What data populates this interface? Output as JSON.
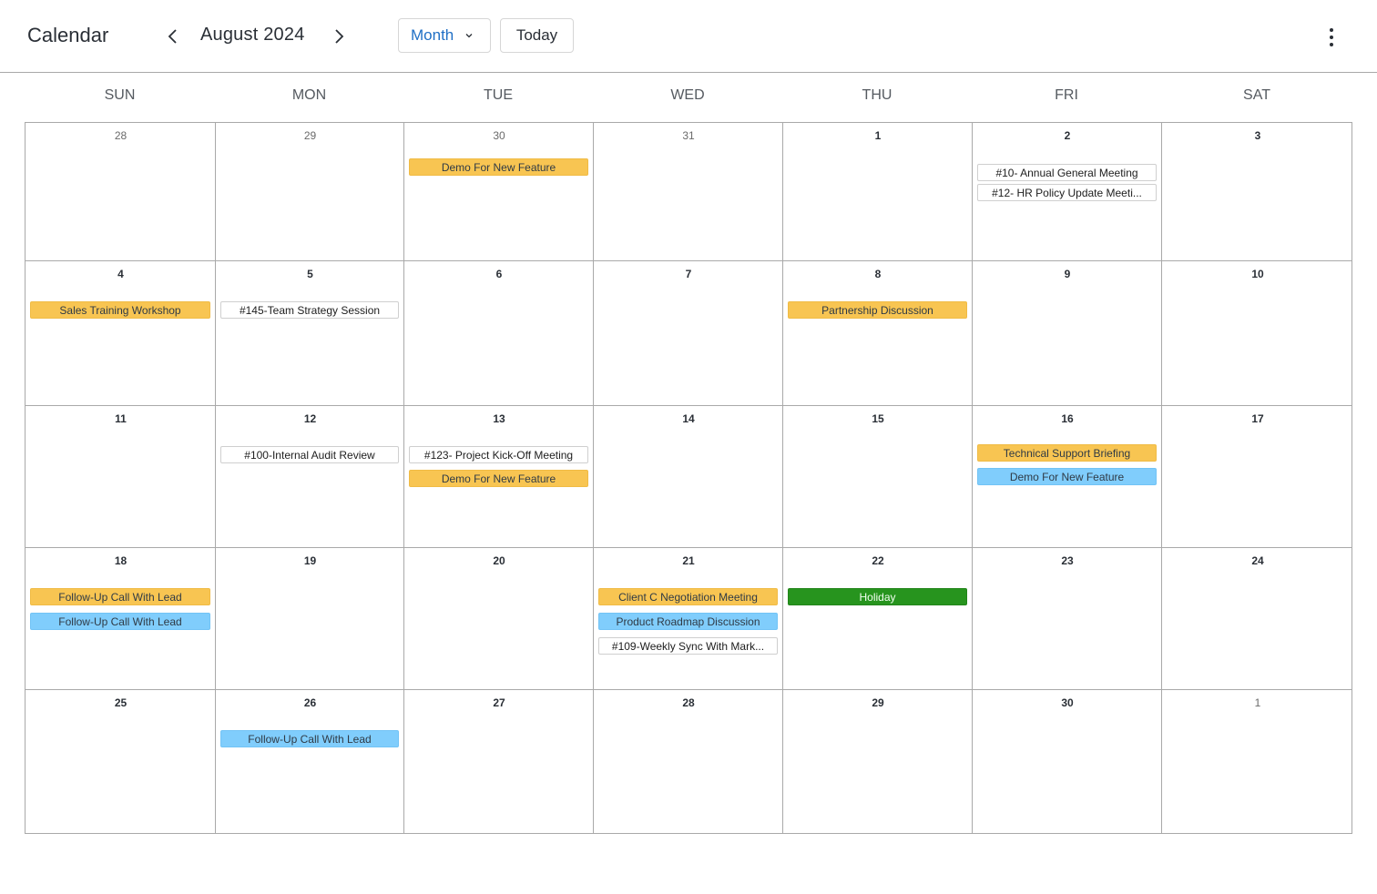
{
  "header": {
    "title": "Calendar",
    "month_label": "August 2024",
    "view_select": "Month",
    "today_label": "Today",
    "icons": {
      "prev": "chevron-left-icon",
      "next": "chevron-right-icon",
      "dropdown": "chevron-down-icon",
      "more": "kebab-menu-icon"
    }
  },
  "weekdays": [
    "SUN",
    "MON",
    "TUE",
    "WED",
    "THU",
    "FRI",
    "SAT"
  ],
  "colors": {
    "orange": "#f8c552",
    "blue": "#80cdfc",
    "green": "#27941e",
    "white": "#ffffff",
    "accent": "#1f6fc5"
  },
  "weeks": [
    [
      {
        "day": "28",
        "current": false,
        "events": []
      },
      {
        "day": "29",
        "current": false,
        "events": []
      },
      {
        "day": "30",
        "current": false,
        "events": [
          {
            "title": "Demo For New Feature",
            "color": "orange"
          }
        ]
      },
      {
        "day": "31",
        "current": false,
        "events": []
      },
      {
        "day": "1",
        "current": true,
        "events": []
      },
      {
        "day": "2",
        "current": true,
        "events": [
          {
            "title": "#10- Annual General Meeting",
            "color": "white"
          },
          {
            "title": "#12- HR Policy Update Meeti...",
            "color": "white"
          }
        ]
      },
      {
        "day": "3",
        "current": true,
        "events": []
      }
    ],
    [
      {
        "day": "4",
        "current": true,
        "events": [
          {
            "title": "Sales Training Workshop",
            "color": "orange"
          }
        ]
      },
      {
        "day": "5",
        "current": true,
        "events": [
          {
            "title": "#145-Team Strategy Session",
            "color": "white"
          }
        ]
      },
      {
        "day": "6",
        "current": true,
        "events": []
      },
      {
        "day": "7",
        "current": true,
        "events": []
      },
      {
        "day": "8",
        "current": true,
        "events": [
          {
            "title": "Partnership Discussion",
            "color": "orange"
          }
        ]
      },
      {
        "day": "9",
        "current": true,
        "events": []
      },
      {
        "day": "10",
        "current": true,
        "events": []
      }
    ],
    [
      {
        "day": "11",
        "current": true,
        "events": []
      },
      {
        "day": "12",
        "current": true,
        "events": [
          {
            "title": "#100-Internal Audit Review",
            "color": "white"
          }
        ]
      },
      {
        "day": "13",
        "current": true,
        "events": [
          {
            "title": "#123- Project Kick-Off Meeting",
            "color": "white"
          },
          {
            "title": "Demo For New Feature",
            "color": "orange"
          }
        ]
      },
      {
        "day": "14",
        "current": true,
        "events": []
      },
      {
        "day": "15",
        "current": true,
        "events": []
      },
      {
        "day": "16",
        "current": true,
        "events": [
          {
            "title": "Technical Support Briefing",
            "color": "orange"
          },
          {
            "title": "Demo For New Feature",
            "color": "blue"
          }
        ]
      },
      {
        "day": "17",
        "current": true,
        "events": []
      }
    ],
    [
      {
        "day": "18",
        "current": true,
        "events": [
          {
            "title": "Follow-Up Call With Lead",
            "color": "orange"
          },
          {
            "title": "Follow-Up Call With Lead",
            "color": "blue"
          }
        ]
      },
      {
        "day": "19",
        "current": true,
        "events": []
      },
      {
        "day": "20",
        "current": true,
        "events": []
      },
      {
        "day": "21",
        "current": true,
        "events": [
          {
            "title": "Client C Negotiation Meeting",
            "color": "orange"
          },
          {
            "title": "Product Roadmap Discussion",
            "color": "blue"
          },
          {
            "title": "#109-Weekly Sync With Mark...",
            "color": "white"
          }
        ]
      },
      {
        "day": "22",
        "current": true,
        "events": [
          {
            "title": "Holiday",
            "color": "green"
          }
        ]
      },
      {
        "day": "23",
        "current": true,
        "events": []
      },
      {
        "day": "24",
        "current": true,
        "events": []
      }
    ],
    [
      {
        "day": "25",
        "current": true,
        "events": []
      },
      {
        "day": "26",
        "current": true,
        "events": [
          {
            "title": "Follow-Up Call With Lead",
            "color": "blue"
          }
        ]
      },
      {
        "day": "27",
        "current": true,
        "events": []
      },
      {
        "day": "28",
        "current": true,
        "events": []
      },
      {
        "day": "29",
        "current": true,
        "events": []
      },
      {
        "day": "30",
        "current": true,
        "events": []
      },
      {
        "day": "1",
        "current": false,
        "events": []
      }
    ]
  ]
}
